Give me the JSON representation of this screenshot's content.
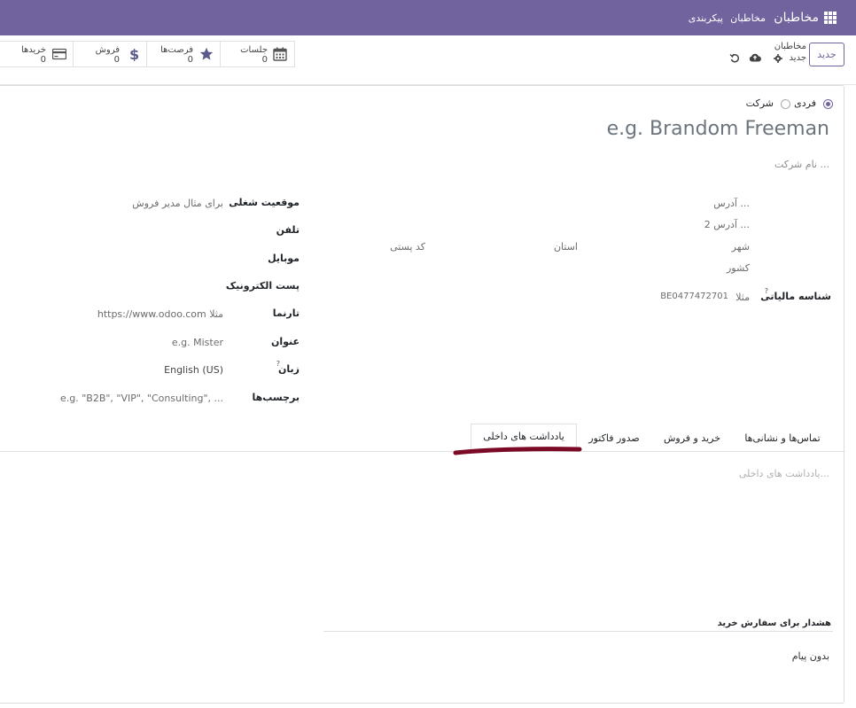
{
  "topbar": {
    "brand": "مخاطبان",
    "menu_contacts": "مخاطبان",
    "menu_config": "پیکربندی"
  },
  "control": {
    "new_button": "جدید",
    "breadcrumb_title": "مخاطبان",
    "breadcrumb_sub": "جدید",
    "stats": [
      {
        "label": "جلسات",
        "value": "0",
        "icon": "calendar-icon"
      },
      {
        "label": "فرصت‌ها",
        "value": "0",
        "icon": "star-icon"
      },
      {
        "label": "فروش",
        "value": "0",
        "icon": "dollar-icon"
      },
      {
        "label": "خریدها",
        "value": "0",
        "icon": "credit-card-icon"
      }
    ]
  },
  "form": {
    "type_individual": "فردی",
    "type_company": "شرکت",
    "name_placeholder": "e.g. Brandom Freeman",
    "company_placeholder": "نام شرکت ...",
    "address": {
      "street": "آدرس ...",
      "street2": "آدرس 2 ...",
      "city": "شهر",
      "state": "استان",
      "zip": "کد پستی",
      "country": "کشور"
    },
    "vat_label": "شناسه مالیاتی",
    "vat_help": "?",
    "vat_prefix": "مثلا",
    "vat_placeholder": "BE0477472701",
    "right_fields": [
      {
        "label": "موقعیت شغلی",
        "value": "برای مثال مدیر فروش"
      },
      {
        "label": "تلفن",
        "value": ""
      },
      {
        "label": "موبایل",
        "value": ""
      },
      {
        "label": "پست الکترونیک",
        "value": ""
      },
      {
        "label": "تارنما",
        "value": "https://www.odoo.com مثلا"
      },
      {
        "label": "عنوان",
        "value": "e.g. Mister"
      },
      {
        "label": "زبان",
        "value": "English (US)"
      },
      {
        "label": "برچسب‌ها",
        "value": "e.g. \"B2B\", \"VIP\", \"Consulting\", ..."
      }
    ],
    "lang_help": "?"
  },
  "tabs": [
    {
      "label": "تماس‌ها و نشانی‌ها",
      "active": false
    },
    {
      "label": "خرید و فروش",
      "active": false
    },
    {
      "label": "صدور فاکتور",
      "active": false
    },
    {
      "label": "یادداشت های داخلی",
      "active": true
    }
  ],
  "notes": {
    "placeholder": "یادداشت های داخلی...",
    "purchase_warning_label": "هشدار برای سفارش خرید",
    "purchase_warning_value": "بدون پیام"
  },
  "colors": {
    "brand": "#71639e",
    "annotation": "#7b0a26"
  }
}
